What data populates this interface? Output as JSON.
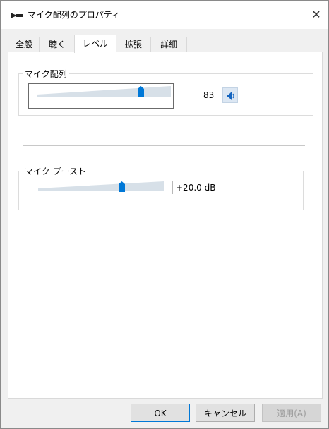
{
  "window": {
    "title": "マイク配列のプロパティ",
    "close_glyph": "✕"
  },
  "tabs": [
    {
      "label": "全般",
      "active": false
    },
    {
      "label": "聴く",
      "active": false
    },
    {
      "label": "レベル",
      "active": true
    },
    {
      "label": "拡張",
      "active": false
    },
    {
      "label": "詳細",
      "active": false
    }
  ],
  "mic_array": {
    "label": "マイク配列",
    "level": 83,
    "level_text": "83",
    "mute_button_icon": "speaker-icon"
  },
  "mic_boost": {
    "label": "マイク ブースト",
    "value_text": "+20.0 dB"
  },
  "buttons": {
    "ok": "OK",
    "cancel": "キャンセル",
    "apply": "適用(A)"
  },
  "colors": {
    "accent": "#0078d7",
    "track": "#d7e0e8",
    "window_bg": "#f0f0f0",
    "panel_bg": "#ffffff"
  }
}
